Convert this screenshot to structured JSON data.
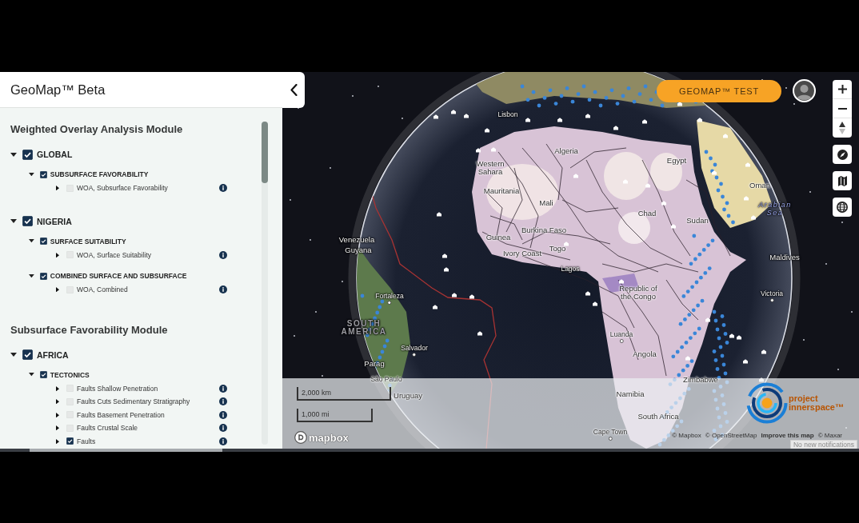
{
  "panel": {
    "title": "GeoMap™ Beta"
  },
  "modules": [
    {
      "title": "Weighted Overlay Analysis Module",
      "groups": [
        {
          "label": "GLOBAL",
          "checked": true,
          "expanded": true,
          "children": [
            {
              "label": "SUBSURFACE FAVORABILITY",
              "checked": true,
              "expanded": true,
              "children": [
                {
                  "label": "WOA, Subsurface Favorability",
                  "checked": false,
                  "expanded": false
                }
              ]
            }
          ]
        },
        {
          "label": "NIGERIA",
          "checked": true,
          "expanded": true,
          "children": [
            {
              "label": "SURFACE SUITABILITY",
              "checked": true,
              "expanded": true,
              "children": [
                {
                  "label": "WOA, Surface Suitability",
                  "checked": false,
                  "expanded": false
                }
              ]
            },
            {
              "label": "COMBINED SURFACE AND SUBSURFACE",
              "checked": true,
              "expanded": true,
              "children": [
                {
                  "label": "WOA, Combined",
                  "checked": false,
                  "expanded": false
                }
              ]
            }
          ]
        }
      ]
    },
    {
      "title": "Subsurface Favorability Module",
      "groups": [
        {
          "label": "AFRICA",
          "checked": true,
          "expanded": true,
          "children": [
            {
              "label": "TECTONICS",
              "checked": true,
              "expanded": true,
              "children": [
                {
                  "label": "Faults Shallow Penetration",
                  "checked": false,
                  "expanded": false
                },
                {
                  "label": "Faults Cuts Sedimentary Stratigraphy",
                  "checked": false,
                  "expanded": false
                },
                {
                  "label": "Faults Basement Penetration",
                  "checked": false,
                  "expanded": false
                },
                {
                  "label": "Faults Crustal Scale",
                  "checked": false,
                  "expanded": false
                },
                {
                  "label": "Faults",
                  "checked": true,
                  "expanded": false
                }
              ]
            }
          ]
        }
      ]
    }
  ],
  "map": {
    "top_button": "GEOMAP™ TEST",
    "labels": [
      {
        "text": "Lisbon",
        "kind": "place"
      },
      {
        "text": "Algeria",
        "kind": "country"
      },
      {
        "text": "Western Sahara",
        "kind": "country"
      },
      {
        "text": "Egypt",
        "kind": "country"
      },
      {
        "text": "Mauritania",
        "kind": "country"
      },
      {
        "text": "Oman",
        "kind": "country"
      },
      {
        "text": "Mali",
        "kind": "country"
      },
      {
        "text": "Chad",
        "kind": "country"
      },
      {
        "text": "Sudan",
        "kind": "country"
      },
      {
        "text": "Arabian Sea",
        "kind": "water"
      },
      {
        "text": "Venezuela",
        "kind": "country"
      },
      {
        "text": "Guinea",
        "kind": "country"
      },
      {
        "text": "Burkina Faso",
        "kind": "country"
      },
      {
        "text": "Guyana",
        "kind": "country"
      },
      {
        "text": "Ivory Coast",
        "kind": "country"
      },
      {
        "text": "Togo",
        "kind": "country"
      },
      {
        "text": "Maldives",
        "kind": "country"
      },
      {
        "text": "Lagos",
        "kind": "place"
      },
      {
        "text": "Fortaleza",
        "kind": "city"
      },
      {
        "text": "Republic of the Congo",
        "kind": "country"
      },
      {
        "text": "Victoria",
        "kind": "city"
      },
      {
        "text": "SOUTH AMERICA",
        "kind": "region"
      },
      {
        "text": "Luanda",
        "kind": "city"
      },
      {
        "text": "Salvador",
        "kind": "city"
      },
      {
        "text": "Angola",
        "kind": "country"
      },
      {
        "text": "Parag",
        "kind": "country"
      },
      {
        "text": "São Paulo",
        "kind": "place"
      },
      {
        "text": "Zimbabwe",
        "kind": "country"
      },
      {
        "text": "Uruguay",
        "kind": "country"
      },
      {
        "text": "Namibia",
        "kind": "country"
      },
      {
        "text": "South Africa",
        "kind": "country"
      },
      {
        "text": "Cape Town",
        "kind": "city"
      }
    ],
    "scale_bars": [
      "2,000 km",
      "1,000 mi"
    ],
    "logo": "mapbox",
    "attribution": [
      {
        "text": "© Mapbox",
        "kind": "credit"
      },
      {
        "text": "© OpenStreetMap",
        "kind": "credit"
      },
      {
        "text": "Improve this map",
        "kind": "action"
      },
      {
        "text": "© Maxar",
        "kind": "credit"
      }
    ],
    "partner_logo": {
      "lines": [
        "project",
        "innerspace™"
      ]
    },
    "notification": "No new notifications"
  }
}
